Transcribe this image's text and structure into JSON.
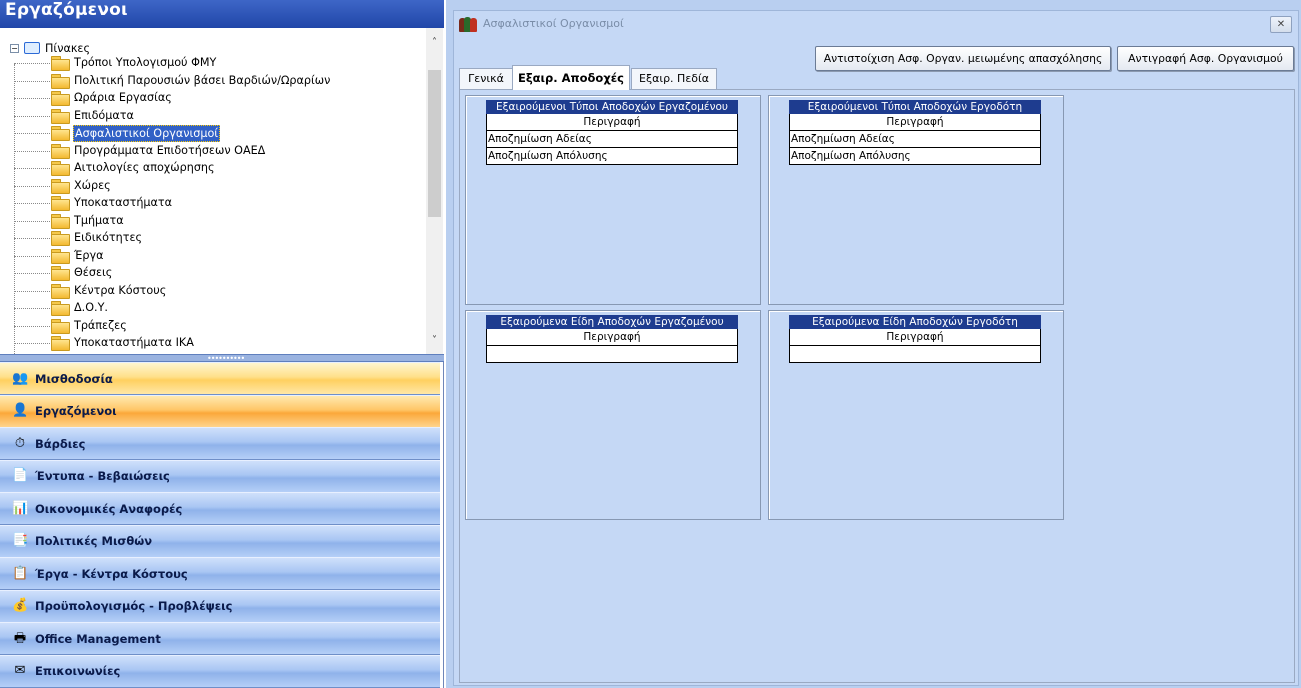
{
  "left": {
    "title": "Εργαζόμενοι",
    "tree": {
      "root_label": "Πίνακες",
      "items": [
        "Τρόποι Υπολογισμού ΦΜΥ",
        "Πολιτική Παρουσιών βάσει Βαρδιών/Ωραρίων",
        "Ωράρια Εργασίας",
        "Επιδόματα",
        "Ασφαλιστικοί Οργανισμοί",
        "Προγράμματα Επιδοτήσεων ΟΑΕΔ",
        "Αιτιολογίες αποχώρησης",
        "Χώρες",
        "Υποκαταστήματα",
        "Τμήματα",
        "Ειδικότητες",
        "Έργα",
        "Θέσεις",
        "Κέντρα Κόστους",
        "Δ.Ο.Υ.",
        "Τράπεζες",
        "Υποκαταστήματα ΙΚΑ"
      ],
      "selected_index": 4
    },
    "nav": [
      {
        "label": "Μισθοδοσία",
        "icon": "people-icon",
        "state": "hover"
      },
      {
        "label": "Εργαζόμενοι",
        "icon": "employee-icon",
        "state": "active"
      },
      {
        "label": "Βάρδιες",
        "icon": "shift-icon",
        "state": ""
      },
      {
        "label": "Έντυπα - Βεβαιώσεις",
        "icon": "forms-icon",
        "state": ""
      },
      {
        "label": "Οικονομικές Αναφορές",
        "icon": "reports-icon",
        "state": ""
      },
      {
        "label": "Πολιτικές Μισθών",
        "icon": "policy-icon",
        "state": ""
      },
      {
        "label": "Έργα - Κέντρα Κόστους",
        "icon": "projects-icon",
        "state": ""
      },
      {
        "label": "Προϋπολογισμός - Προβλέψεις",
        "icon": "budget-icon",
        "state": ""
      },
      {
        "label": "Office Management",
        "icon": "office-icon",
        "state": ""
      },
      {
        "label": "Επικοινωνίες",
        "icon": "communications-icon",
        "state": ""
      }
    ]
  },
  "window": {
    "title": "Ασφαλιστικοί Οργανισμοί",
    "close_glyph": "✕",
    "buttons": {
      "map": "Αντιστοίχιση Ασφ. Οργαν. μειωμένης απασχόλησης",
      "copy": "Αντιγραφή Ασφ. Οργανισμού"
    },
    "tabs": [
      "Γενικά",
      "Εξαιρ. Αποδοχές",
      "Εξαιρ. Πεδία"
    ],
    "active_tab": 1,
    "panels": [
      {
        "title": "Εξαιρούμενοι Τύποι Αποδοχών Εργαζομένου",
        "header": "Περιγραφή",
        "rows": [
          "Αποζημίωση Αδείας",
          "Αποζημίωση Απόλυσης"
        ]
      },
      {
        "title": "Εξαιρούμενοι Τύποι Αποδοχών Εργοδότη",
        "header": "Περιγραφή",
        "rows": [
          "Αποζημίωση Αδείας",
          "Αποζημίωση Απόλυσης"
        ]
      },
      {
        "title": "Εξαιρούμενα Είδη Αποδοχών Εργαζομένου",
        "header": "Περιγραφή",
        "rows": [
          ""
        ]
      },
      {
        "title": "Εξαιρούμενα Είδη Αποδοχών Εργοδότη",
        "header": "Περιγραφή",
        "rows": [
          ""
        ]
      }
    ]
  }
}
